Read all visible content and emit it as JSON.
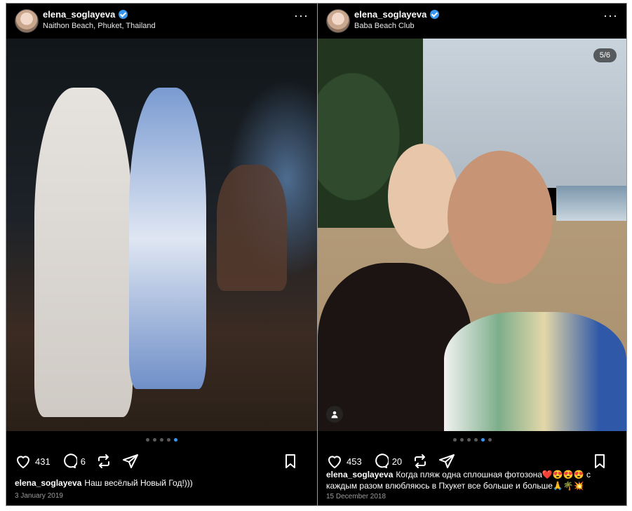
{
  "posts": [
    {
      "username": "elena_soglayeva",
      "location": "Naithon Beach, Phuket, Thailand",
      "likes": "431",
      "comments": "6",
      "caption_user": "elena_soglayeva",
      "caption_text": "Наш весёлый Новый Год!)))",
      "date": "3 January 2019",
      "carousel": {
        "count": 5,
        "active_index": 4
      }
    },
    {
      "username": "elena_soglayeva",
      "location": "Baba Beach Club",
      "image_counter": "5/6",
      "likes": "453",
      "comments": "20",
      "caption_user": "elena_soglayeva",
      "caption_text": "Когда пляж одна сплошная фотозона❤️😍😍😍 с каждым разом влюбляюсь в Пхукет все больше и больше🙏🌴💥",
      "date": "15 December 2018",
      "carousel": {
        "count": 6,
        "active_index": 4
      }
    }
  ],
  "colors": {
    "accent": "#3897f0",
    "background": "#000000"
  }
}
